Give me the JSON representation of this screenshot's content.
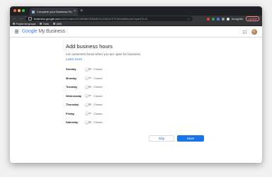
{
  "browser": {
    "tab_title": "Complete your Business Profi",
    "tab_close": "×",
    "new_tab": "+",
    "url_host": "business.google.com",
    "url_path": "/u/0/create/2/D16MBA7B5ABCD1Z0EA7E7F4e/edit/hours?openTo=0",
    "incognito_label": "Incognito",
    "update_label": "Update",
    "bookmarks": [
      "Project list groups",
      "Tools",
      "AWS"
    ]
  },
  "app": {
    "logo_google": "Google",
    "logo_product": "My Business"
  },
  "page": {
    "title": "Add business hours",
    "subtitle": "Let customers know when you are open for business",
    "learn_more": "Learn more",
    "days": [
      {
        "name": "Sunday",
        "status": "Closed",
        "open": false
      },
      {
        "name": "Monday",
        "status": "Closed",
        "open": false
      },
      {
        "name": "Tuesday",
        "status": "Closed",
        "open": false
      },
      {
        "name": "Wednesday",
        "status": "Closed",
        "open": false
      },
      {
        "name": "Thursday",
        "status": "Closed",
        "open": false
      },
      {
        "name": "Friday",
        "status": "Closed",
        "open": false
      },
      {
        "name": "Saturday",
        "status": "Closed",
        "open": false
      }
    ],
    "skip_label": "Skip",
    "save_label": "Save"
  },
  "colors": {
    "accent": "#1a73e8",
    "chrome_dark": "#202124",
    "toggle_off": "#c7c7c7"
  }
}
